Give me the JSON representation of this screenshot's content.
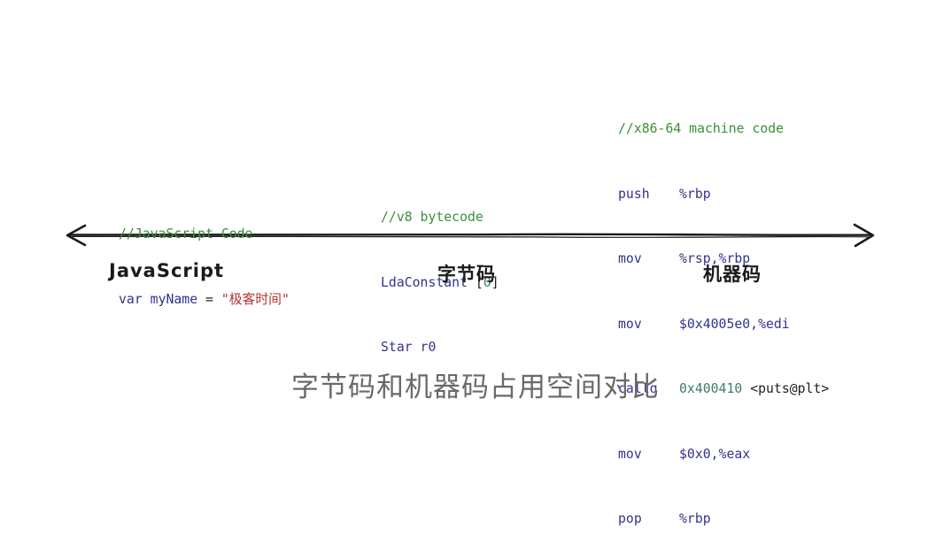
{
  "javascript_block": {
    "comment": "//JavaScript Code",
    "keyword": "var",
    "identifier": "myName",
    "operator": "=",
    "string_literal": "\"极客时间\""
  },
  "bytecode_block": {
    "comment": "//v8 bytecode",
    "line1_instr": "LdaConstant",
    "line1_arg_open": "[",
    "line1_arg_value": "0",
    "line1_arg_close": "]",
    "line2": "Star r0"
  },
  "machine_code_block": {
    "comment": "//x86-64 machine code",
    "rows": [
      {
        "opcode": "push",
        "operand": "%rbp"
      },
      {
        "opcode": "mov",
        "operand": "%rsp,%rbp"
      },
      {
        "opcode": "mov",
        "operand": "$0x4005e0,%edi"
      },
      {
        "opcode": "callq",
        "operand": "0x400410",
        "tag": "<puts@plt>"
      },
      {
        "opcode": "mov",
        "operand": "$0x0,%eax"
      },
      {
        "opcode": "pop",
        "operand": "%rbp"
      }
    ]
  },
  "axis_labels": {
    "javascript": "JavaScript",
    "bytecode": "字节码",
    "machine_code": "机器码"
  },
  "caption": "字节码和机器码占用空间对比"
}
